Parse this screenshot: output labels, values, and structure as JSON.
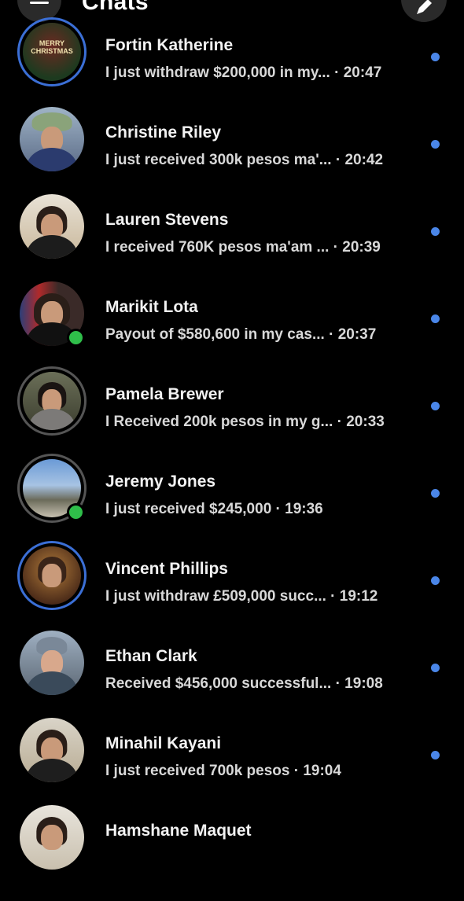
{
  "header": {
    "title": "Chats",
    "menu_icon": "hamburger-icon",
    "compose_icon": "pencil-icon"
  },
  "colors": {
    "background": "#000000",
    "unread": "#4a86e8",
    "online": "#2fbe4a",
    "story_ring": "#3b6fd6"
  },
  "chats": [
    {
      "name": "Fortin Katherine",
      "preview": "I just withdraw $200,000 in my... · 20:47",
      "avatar_text": "MERRY CHRISTMAS",
      "story": true,
      "online": false,
      "unread": true
    },
    {
      "name": "Christine Riley",
      "preview": "I just received 300k pesos ma'... · 20:42",
      "story": false,
      "online": false,
      "unread": true
    },
    {
      "name": "Lauren Stevens",
      "preview": "I received 760K pesos ma'am ... · 20:39",
      "story": false,
      "online": false,
      "unread": true
    },
    {
      "name": "Marikit Lota",
      "preview": "Payout of $580,600 in my cas... · 20:37",
      "story": false,
      "online": true,
      "unread": true
    },
    {
      "name": "Pamela Brewer",
      "preview": "I Received 200k pesos in my g... · 20:33",
      "story": false,
      "seen_ring": true,
      "online": false,
      "unread": true
    },
    {
      "name": "Jeremy Jones",
      "preview": "I just received $245,000 · 19:36",
      "story": false,
      "seen_ring": true,
      "online": true,
      "unread": true
    },
    {
      "name": "Vincent Phillips",
      "preview": "I just withdraw £509,000 succ... · 19:12",
      "story": true,
      "online": false,
      "unread": true
    },
    {
      "name": "Ethan Clark",
      "preview": "Received $456,000 successful... · 19:08",
      "story": false,
      "online": false,
      "unread": true
    },
    {
      "name": "Minahil Kayani",
      "preview": "I just received 700k pesos · 19:04",
      "story": false,
      "online": false,
      "unread": true
    },
    {
      "name": "Hamshane Maquet",
      "preview": "",
      "story": false,
      "online": false,
      "unread": false
    }
  ]
}
